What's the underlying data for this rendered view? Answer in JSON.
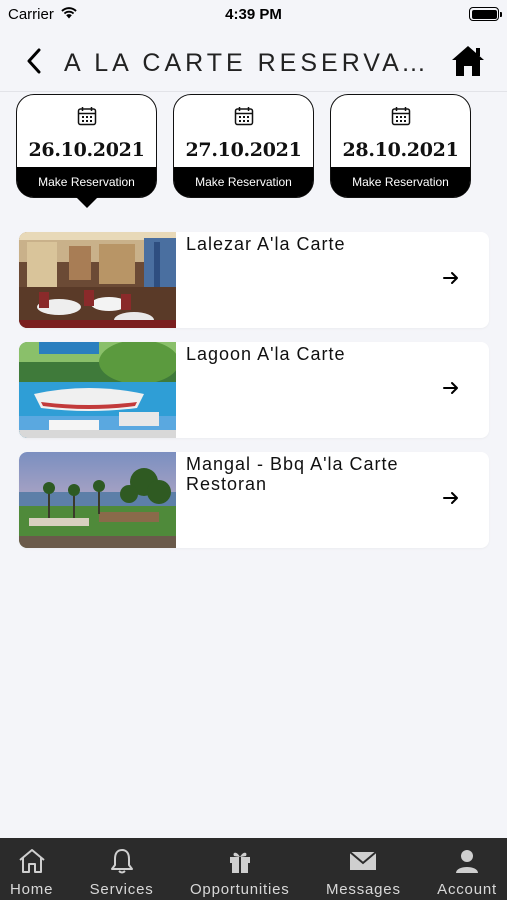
{
  "status_bar": {
    "carrier": "Carrier",
    "time": "4:39 PM"
  },
  "header": {
    "title": "A LA CARTE RESERVATI..."
  },
  "dates": [
    {
      "date": "26.10.2021",
      "action": "Make Reservation",
      "selected": true
    },
    {
      "date": "27.10.2021",
      "action": "Make Reservation",
      "selected": false
    },
    {
      "date": "28.10.2021",
      "action": "Make Reservation",
      "selected": false
    }
  ],
  "restaurants": [
    {
      "name": "Lalezar A'la Carte",
      "image": "restaurant-interior"
    },
    {
      "name": "Lagoon A'la Carte",
      "image": "poolside-terrace"
    },
    {
      "name": "Mangal - Bbq A'la Carte Restoran",
      "image": "seaside-garden"
    }
  ],
  "tabbar": {
    "items": [
      {
        "label": "Home",
        "icon": "home-icon"
      },
      {
        "label": "Services",
        "icon": "bell-icon"
      },
      {
        "label": "Opportunities",
        "icon": "gift-icon"
      },
      {
        "label": "Messages",
        "icon": "envelope-icon"
      },
      {
        "label": "Account",
        "icon": "person-icon"
      }
    ]
  },
  "colors": {
    "background": "#f4f5f9",
    "tabbar": "#2b2b2b",
    "accent": "#000000"
  }
}
